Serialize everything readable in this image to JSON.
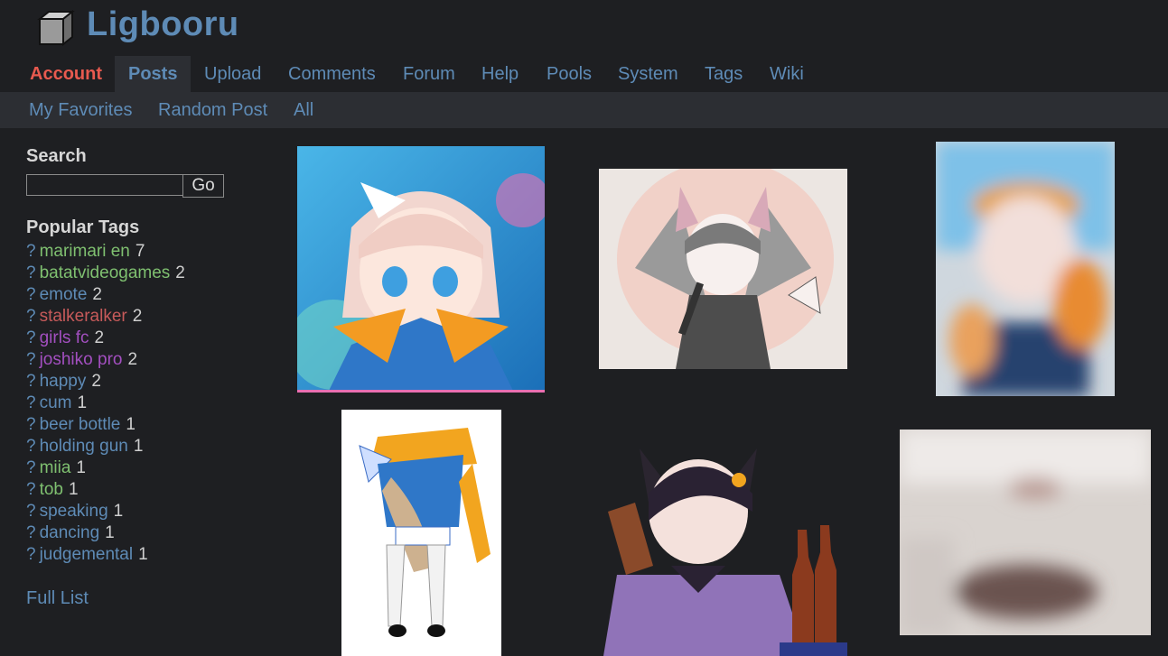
{
  "header": {
    "site_title": "Ligbooru",
    "logo_icon": "cube-icon"
  },
  "nav": {
    "items": [
      {
        "label": "Account"
      },
      {
        "label": "Posts"
      },
      {
        "label": "Upload"
      },
      {
        "label": "Comments"
      },
      {
        "label": "Forum"
      },
      {
        "label": "Help"
      },
      {
        "label": "Pools"
      },
      {
        "label": "System"
      },
      {
        "label": "Tags"
      },
      {
        "label": "Wiki"
      }
    ],
    "active": "Posts"
  },
  "subnav": {
    "items": [
      {
        "label": "My Favorites"
      },
      {
        "label": "Random Post"
      },
      {
        "label": "All"
      }
    ]
  },
  "sidebar": {
    "search_title": "Search",
    "search_value": "",
    "go_label": "Go",
    "popular_tags_title": "Popular Tags",
    "tags": [
      {
        "q": "?",
        "name": "marimari en",
        "count": "7",
        "color": "#7fc070"
      },
      {
        "q": "?",
        "name": "batatvideogames",
        "count": "2",
        "color": "#7fc070"
      },
      {
        "q": "?",
        "name": "emote",
        "count": "2",
        "color": "#5e8bb6"
      },
      {
        "q": "?",
        "name": "stalkeralker",
        "count": "2",
        "color": "#c65a5a"
      },
      {
        "q": "?",
        "name": "girls fc",
        "count": "2",
        "color": "#a34fc0"
      },
      {
        "q": "?",
        "name": "joshiko pro",
        "count": "2",
        "color": "#a34fc0"
      },
      {
        "q": "?",
        "name": "happy",
        "count": "2",
        "color": "#5e8bb6"
      },
      {
        "q": "?",
        "name": "cum",
        "count": "1",
        "color": "#5e8bb6"
      },
      {
        "q": "?",
        "name": "beer bottle",
        "count": "1",
        "color": "#5e8bb6"
      },
      {
        "q": "?",
        "name": "holding gun",
        "count": "1",
        "color": "#5e8bb6"
      },
      {
        "q": "?",
        "name": "miia",
        "count": "1",
        "color": "#7fc070"
      },
      {
        "q": "?",
        "name": "tob",
        "count": "1",
        "color": "#7fc070"
      },
      {
        "q": "?",
        "name": "speaking",
        "count": "1",
        "color": "#5e8bb6"
      },
      {
        "q": "?",
        "name": "dancing",
        "count": "1",
        "color": "#5e8bb6"
      },
      {
        "q": "?",
        "name": "judgemental",
        "count": "1",
        "color": "#5e8bb6"
      }
    ],
    "full_list_label": "Full List"
  }
}
